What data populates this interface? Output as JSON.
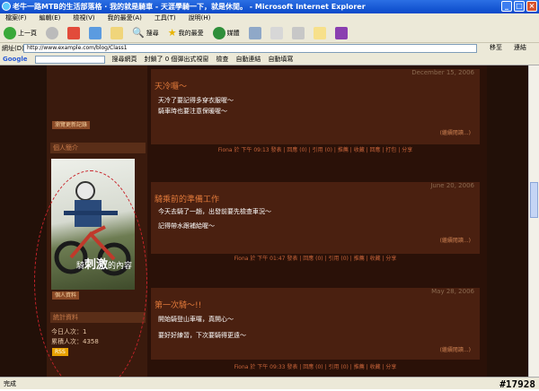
{
  "window": {
    "title": "老牛一路MTB的生活部落格 · 我的就是騎車 - 天涯學騎一下，就是休閒。 - Microsoft Internet Explorer"
  },
  "menu": [
    "檔案(F)",
    "編輯(E)",
    "檢視(V)",
    "我的最愛(A)",
    "工具(T)",
    "說明(H)"
  ],
  "toolbar": {
    "back": "上一頁",
    "search": "搜尋",
    "favorites": "我的最愛",
    "media": "媒體"
  },
  "address": {
    "label": "網址(D)",
    "value": "http://www.example.com/blog/Class1",
    "go": "移至",
    "links": "連結"
  },
  "googlebar": {
    "brand": "Google",
    "search_btn": "搜尋網頁",
    "items": [
      "封鎖了 0 個彈出式視窗",
      "檢查",
      "自動連結",
      "自動填寫"
    ]
  },
  "sidebar": {
    "btn_top": "瀏覽更新記錄",
    "head_photo": "個人簡介",
    "photo_caption_a": "騎",
    "photo_caption_b": "刺激",
    "photo_caption_c": "的內容",
    "btn_profile": "個人資料",
    "head_stats": "統計資料",
    "stat_today": "今日人次：1",
    "stat_total": "累積人次：4358",
    "rss": "RSS"
  },
  "posts": [
    {
      "date": "December 15, 2006",
      "title": "天冷囉～",
      "lines": [
        "天冷了要記得多穿衣服喔～",
        "騎車時也要注意保暖喔～"
      ],
      "more": "(繼續閱讀...)",
      "footer": "Fiona 於 下午 09:13 發表 | 回應 (0) | 引用 (0) | 推薦 | 收藏 | 回應 | 打包 | 分享"
    },
    {
      "date": "June 20, 2006",
      "title": "騎乘前的準備工作",
      "lines": [
        "今天去騎了一趟，出發前要先檢查車況～",
        "記得帶水跟補給喔～"
      ],
      "more": "(繼續閱讀...)",
      "footer": "Fiona 於 下午 01:47 發表 | 回應 (0) | 引用 (0) | 推薦 | 收藏 | 分享"
    },
    {
      "date": "May 28, 2006",
      "title": "第一次騎～!!",
      "lines": [
        "開始騎登山車囉，真開心～",
        "要好好練習，下次要騎得更遠～"
      ],
      "more": "(繼續閱讀...)",
      "footer": "Fiona 於 下午 09:33 發表 | 回應 (0) | 引用 (0) | 推薦 | 收藏 | 分享"
    }
  ],
  "status": {
    "text": "完成",
    "watermark": "#17928"
  },
  "colors": {
    "page_bg": "#221008",
    "post_bg": "#4a2010",
    "title_orange": "#e0793a",
    "annotation_red": "#c8232a"
  }
}
